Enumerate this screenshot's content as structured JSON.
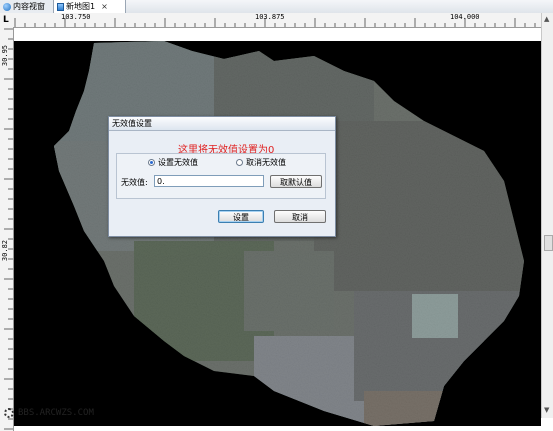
{
  "tabs": [
    {
      "label": "内容视窗"
    },
    {
      "label": "新地图1",
      "close": "×"
    }
  ],
  "ruler": {
    "corner": "L",
    "x_ticks": [
      "103.750",
      "103.875",
      "104.000"
    ],
    "y_ticks": [
      "30.95",
      "30.82"
    ]
  },
  "dialog": {
    "title": "无效值设置",
    "annotation": "这里将无效值设置为0",
    "radio_set": "设置无效值",
    "radio_cancel": "取消无效值",
    "field_label": "无效值:",
    "field_value": "0.",
    "default_button": "取默认值",
    "ok_button": "设置",
    "cancel_button": "取消"
  },
  "watermark": "BBS.ARCWZS.COM",
  "colors": {
    "annotation": "#e02020",
    "canvas": "#000000"
  }
}
